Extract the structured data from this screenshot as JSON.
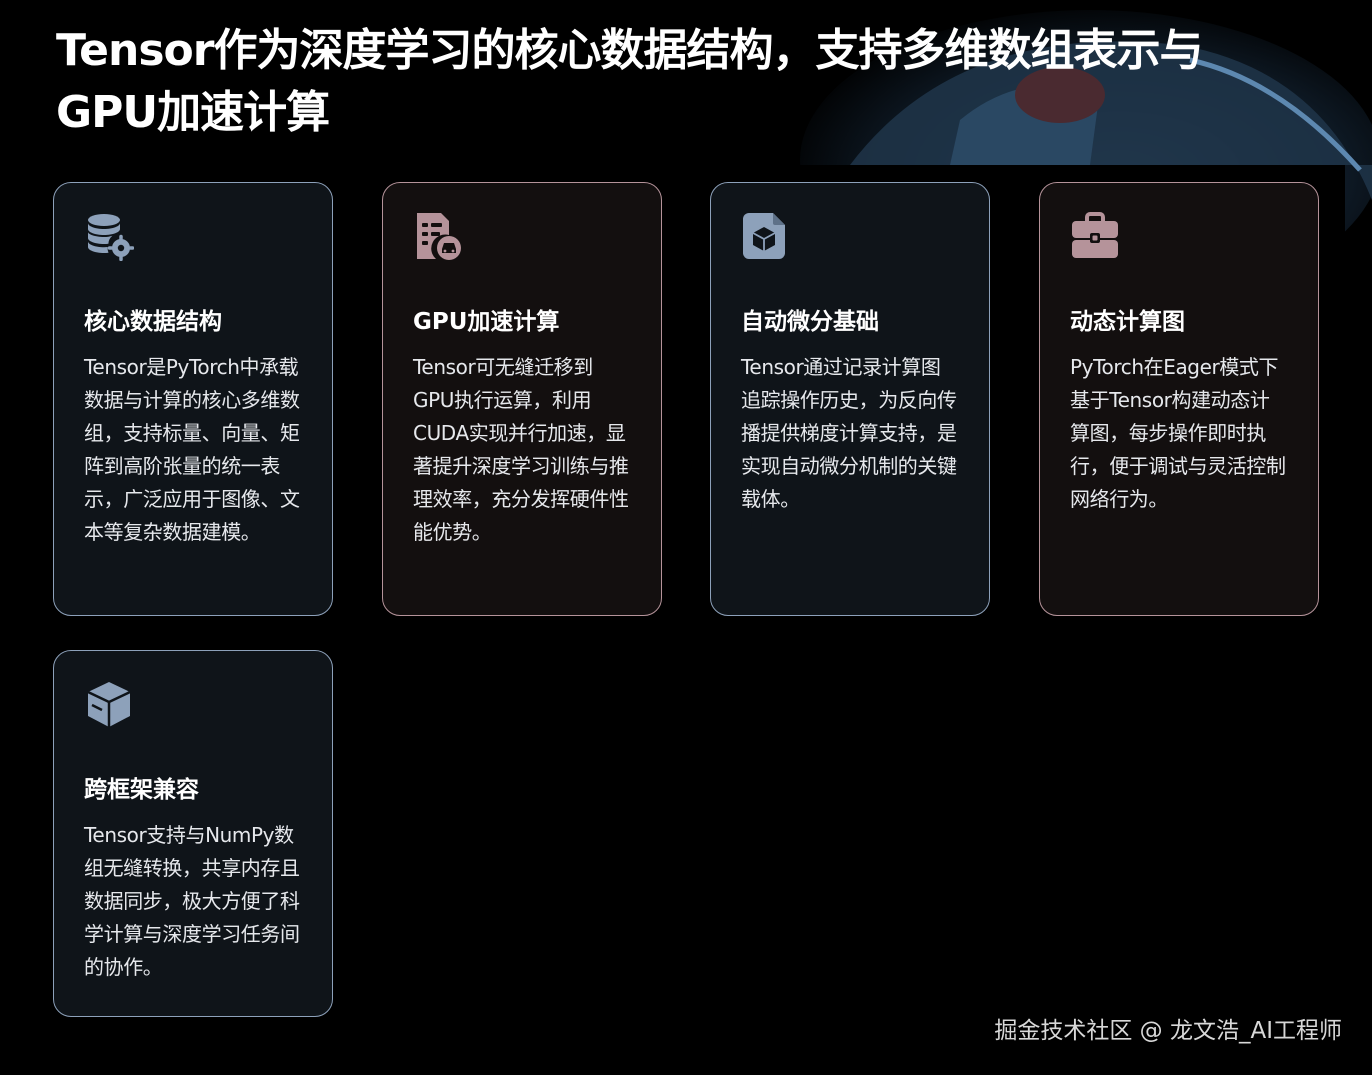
{
  "header": {
    "title_line1": "Tensor作为深度学习的核心数据结构，支持多维数组表示与",
    "title_line2": "GPU加速计算"
  },
  "cards": [
    {
      "icon": "database-gear-icon",
      "title": "核心数据结构",
      "body": "Tensor是PyTorch中承载数据与计算的核心多维数组，支持标量、向量、矩阵到高阶张量的统一表示，广泛应用于图像、文本等复杂数据建模。"
    },
    {
      "icon": "file-car-icon",
      "title": "GPU加速计算",
      "body": "Tensor可无缝迁移到GPU执行运算，利用CUDA实现并行加速，显著提升深度学习训练与推理效率，充分发挥硬件性能优势。"
    },
    {
      "icon": "file-cube-icon",
      "title": "自动微分基础",
      "body": "Tensor通过记录计算图追踪操作历史，为反向传播提供梯度计算支持，是实现自动微分机制的关键载体。"
    },
    {
      "icon": "toolbox-icon",
      "title": "动态计算图",
      "body": "PyTorch在Eager模式下基于Tensor构建动态计算图，每步操作即时执行，便于调试与灵活控制网络行为。"
    },
    {
      "icon": "box-icon",
      "title": "跨框架兼容",
      "body": "Tensor支持与NumPy数组无缝转换，共享内存且数据同步，极大方便了科学计算与深度学习任务间的协作。"
    }
  ],
  "colors": {
    "blue_accent": "#8da1ba",
    "pink_accent": "#b5939a"
  },
  "footer": {
    "watermark": "掘金技术社区 @ 龙文浩_AI工程师"
  }
}
